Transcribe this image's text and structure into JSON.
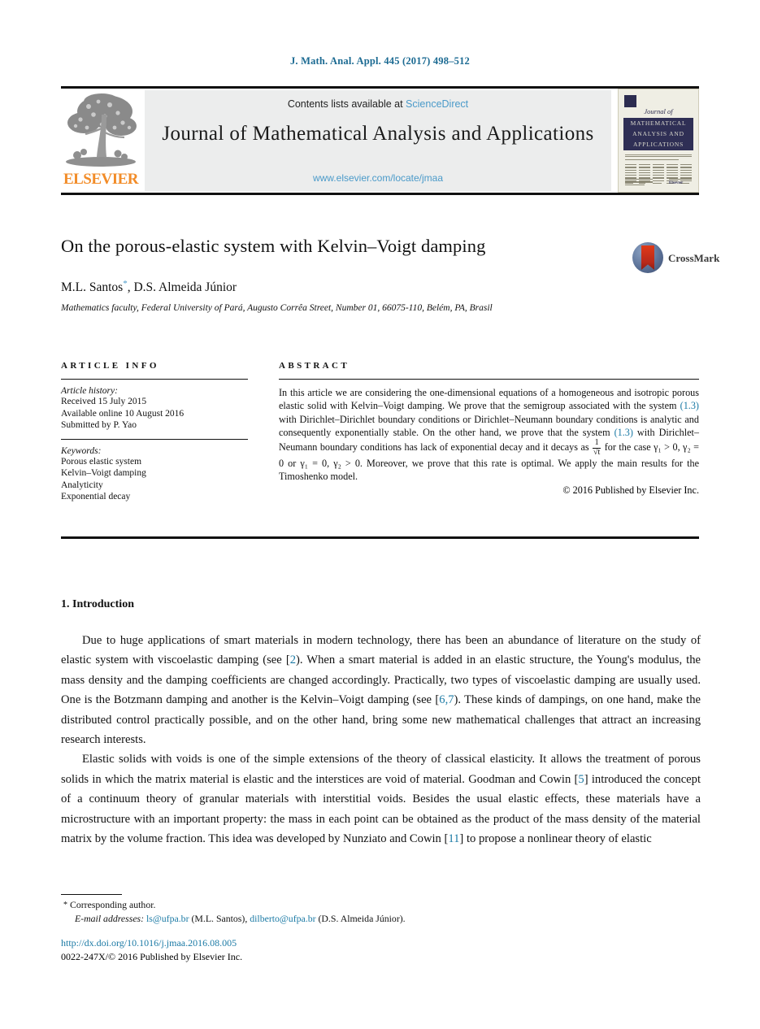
{
  "running_head": "J. Math. Anal. Appl. 445 (2017) 498–512",
  "masthead": {
    "publisher": "ELSEVIER",
    "contents_prefix": "Contents lists available at ",
    "contents_link": "ScienceDirect",
    "journal_title": "Journal of Mathematical Analysis and Applications",
    "journal_url": "www.elsevier.com/locate/jmaa",
    "cover": {
      "journal_of": "Journal of",
      "line1": "MATHEMATICAL",
      "line2": "ANALYSIS AND",
      "line3": "APPLICATIONS",
      "imprint": "Elsevier"
    }
  },
  "article": {
    "title": "On the porous-elastic system with Kelvin–Voigt damping",
    "authors": "M.L. Santos",
    "authors_rest": ", D.S. Almeida Júnior",
    "author_marker": "*",
    "affiliation": "Mathematics faculty, Federal University of Pará, Augusto Corrêa Street, Number 01, 66075-110, Belém, PA, Brasil",
    "crossmark_label": "CrossMark"
  },
  "article_info": {
    "heading": "ARTICLE INFO",
    "history_label": "Article history:",
    "history": [
      "Received 15 July 2015",
      "Available online 10 August 2016",
      "Submitted by P. Yao"
    ],
    "keywords_label": "Keywords:",
    "keywords": [
      "Porous elastic system",
      "Kelvin–Voigt damping",
      "Analyticity",
      "Exponential decay"
    ]
  },
  "abstract": {
    "heading": "ABSTRACT",
    "part1": "In this article we are considering the one-dimensional equations of a homogeneous and isotropic porous elastic solid with Kelvin–Voigt damping. We prove that the semigroup associated with the system ",
    "ref1": "(1.3)",
    "part2": " with Dirichlet–Dirichlet boundary conditions or Dirichlet–Neumann boundary conditions is analytic and consequently exponentially stable. On the other hand, we prove that the system ",
    "ref2": "(1.3)",
    "part3": " with Dirichlet–Neumann boundary conditions has lack of exponential decay and it decays as ",
    "frac_num": "1",
    "frac_den": "√t",
    "part4": " for the case γ₁ > 0, γ₂ = 0 or γ₁ = 0, γ₂ > 0. Moreover, we prove that this rate is optimal. We apply the main results for the Timoshenko model.",
    "copyright": "© 2016 Published by Elsevier Inc."
  },
  "body": {
    "section_number_title": "1. Introduction",
    "paragraph1_a": "Due to huge applications of smart materials in modern technology, there has been an abundance of literature on the study of elastic system with viscoelastic damping (see ",
    "paragraph1_ref1": "2",
    "paragraph1_b": "). When a smart material is added in an elastic structure, the Young's modulus, the mass density and the damping coefficients are changed accordingly. Practically, two types of viscoelastic damping are usually used. One is the Botzmann damping and another is the Kelvin–Voigt damping (see ",
    "paragraph1_ref2": "6,7",
    "paragraph1_c": "). These kinds of dampings, on one hand, make the distributed control practically possible, and on the other hand, bring some new mathematical challenges that attract an increasing research interests.",
    "paragraph2_a": "Elastic solids with voids is one of the simple extensions of the theory of classical elasticity. It allows the treatment of porous solids in which the matrix material is elastic and the interstices are void of material. Goodman and Cowin ",
    "paragraph2_ref1": "5",
    "paragraph2_b": " introduced the concept of a continuum theory of granular materials with interstitial voids. Besides the usual elastic effects, these materials have a microstructure with an important property: the mass in each point can be obtained as the product of the mass density of the material matrix by the volume fraction. This idea was developed by Nunziato and Cowin ",
    "paragraph2_ref2": "11",
    "paragraph2_c": " to propose a nonlinear theory of elastic"
  },
  "footer": {
    "corresponding_marker": "*",
    "corresponding_text": "Corresponding author.",
    "email_label": "E-mail addresses:",
    "email1": "ls@ufpa.br",
    "email1_owner": "(M.L. Santos),",
    "email2": "dilberto@ufpa.br",
    "email2_owner": "(D.S. Almeida Júnior).",
    "doi": "http://dx.doi.org/10.1016/j.jmaa.2016.08.005",
    "issn_line": "0022-247X/© 2016 Published by Elsevier Inc."
  },
  "colors": {
    "link": "#1b7aa5",
    "light_link": "#4a9ac9",
    "running_head": "#1b6a92",
    "elsevier_orange": "#F28C28",
    "band_bg": "#eceded",
    "cover_navy": "#2f2f55"
  }
}
